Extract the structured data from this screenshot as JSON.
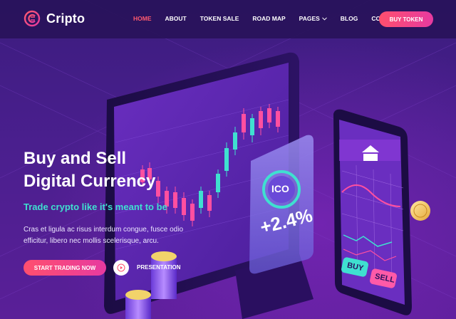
{
  "brand": {
    "name": "Cripto"
  },
  "nav": {
    "items": [
      {
        "label": "HOME",
        "active": true
      },
      {
        "label": "ABOUT"
      },
      {
        "label": "TOKEN SALE"
      },
      {
        "label": "ROAD MAP"
      },
      {
        "label": "PAGES",
        "dropdown": true
      },
      {
        "label": "BLOG"
      },
      {
        "label": "CONTACT"
      }
    ],
    "cta_label": "BUY TOKEN"
  },
  "hero": {
    "title_line1": "Buy and Sell",
    "title_line2": "Digital Currency",
    "subtitle": "Trade crypto like it's meant to be",
    "description": "Cras et ligula ac risus interdum congue, fusce odio efficitur, libero nec mollis scelerisque, arcu.",
    "primary_cta": "START TRADING NOW",
    "secondary_cta": "PRESENTATION"
  },
  "illustration": {
    "ico_label": "ICO",
    "ico_change": "+2.4%",
    "phone_buy": "BUY",
    "phone_sell": "SELL"
  },
  "colors": {
    "accent": "#ff4f6e",
    "accent2": "#e73aa0",
    "teal": "#3fe0d0",
    "bg": "#3b1c7e"
  }
}
